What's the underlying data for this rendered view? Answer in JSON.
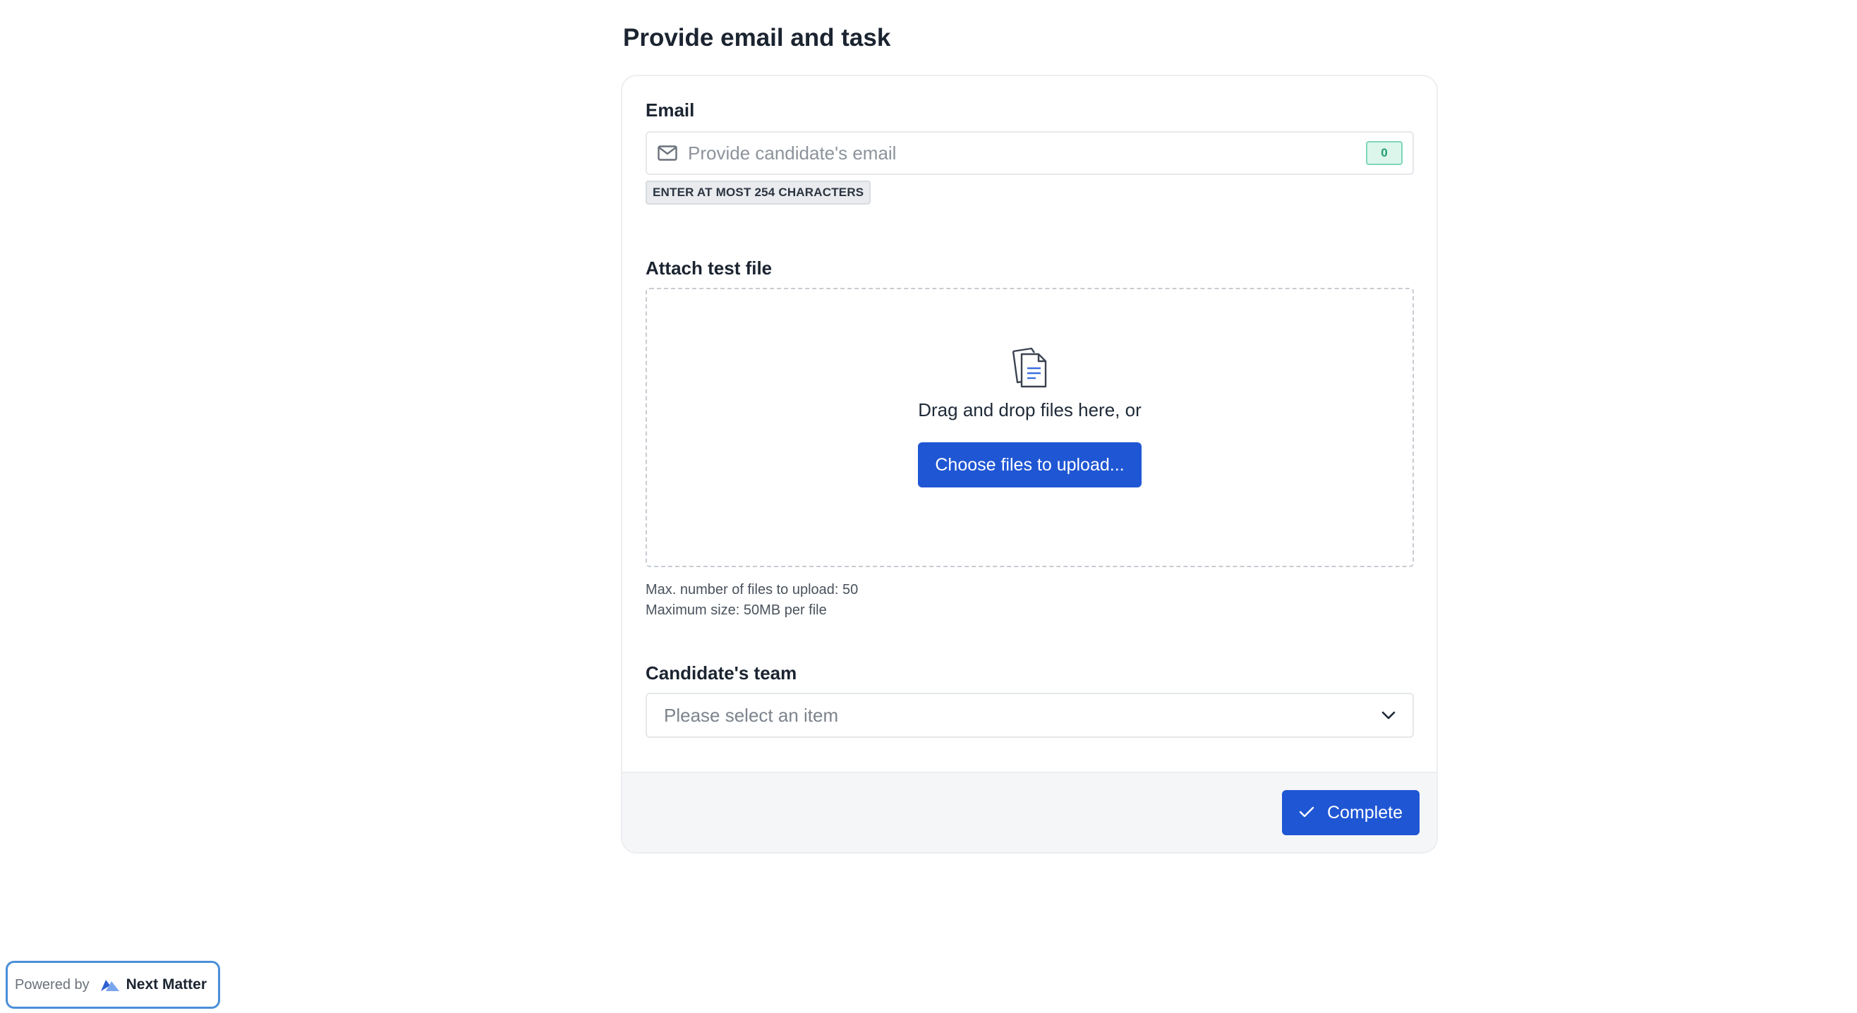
{
  "page": {
    "title": "Provide email and task"
  },
  "email": {
    "label": "Email",
    "placeholder": "Provide candidate's email",
    "char_count": "0",
    "hint": "ENTER AT MOST 254 CHARACTERS",
    "icon": "mail-icon"
  },
  "attachment": {
    "label": "Attach test file",
    "drag_text": "Drag and drop files here, or",
    "button_label": "Choose files to upload...",
    "max_files_text": "Max. number of files to upload: 50",
    "max_size_text": "Maximum size: 50MB per file",
    "icon": "document-icon"
  },
  "team": {
    "label": "Candidate's team",
    "placeholder": "Please select an item",
    "icon": "chevron-down-icon"
  },
  "footer": {
    "complete_label": "Complete",
    "icon": "check-icon"
  },
  "branding": {
    "powered_by": "Powered by",
    "name": "Next Matter"
  },
  "colors": {
    "primary": "#1f56d4",
    "counter_bg": "#dcf6ec",
    "counter_text": "#1f9c72",
    "powered_border": "#4a8fd8"
  }
}
